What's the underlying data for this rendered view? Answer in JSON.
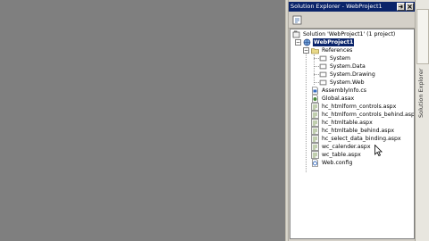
{
  "explorer": {
    "title": "Solution Explorer - WebProject1",
    "side_tab_label": "Solution Explorer"
  },
  "tree": {
    "solution": "Solution 'WebProject1' (1 project)",
    "project": "WebProject1",
    "references_label": "References",
    "references": [
      "System",
      "System.Data",
      "System.Drawing",
      "System.Web"
    ],
    "files": [
      {
        "name": "AssemblyInfo.cs",
        "icon": "csharp-file-icon"
      },
      {
        "name": "Global.asax",
        "icon": "asax-file-icon"
      },
      {
        "name": "hc_htmlform_controls.aspx",
        "icon": "aspx-file-icon"
      },
      {
        "name": "hc_htmlform_controls_behind.aspx",
        "icon": "aspx-file-icon"
      },
      {
        "name": "hc_htmltable.aspx",
        "icon": "aspx-file-icon"
      },
      {
        "name": "hc_htmltable_behind.aspx",
        "icon": "aspx-file-icon"
      },
      {
        "name": "hc_select_data_binding.aspx",
        "icon": "aspx-file-icon"
      },
      {
        "name": "wc_calender.aspx",
        "icon": "aspx-file-icon"
      },
      {
        "name": "wc_table.aspx",
        "icon": "aspx-file-icon"
      },
      {
        "name": "Web.config",
        "icon": "config-file-icon"
      }
    ]
  },
  "colors": {
    "workspace": "#7f7f7f",
    "titlebar": "#0a246a",
    "panel": "#d4d0c8",
    "selection": "#0a246a"
  }
}
